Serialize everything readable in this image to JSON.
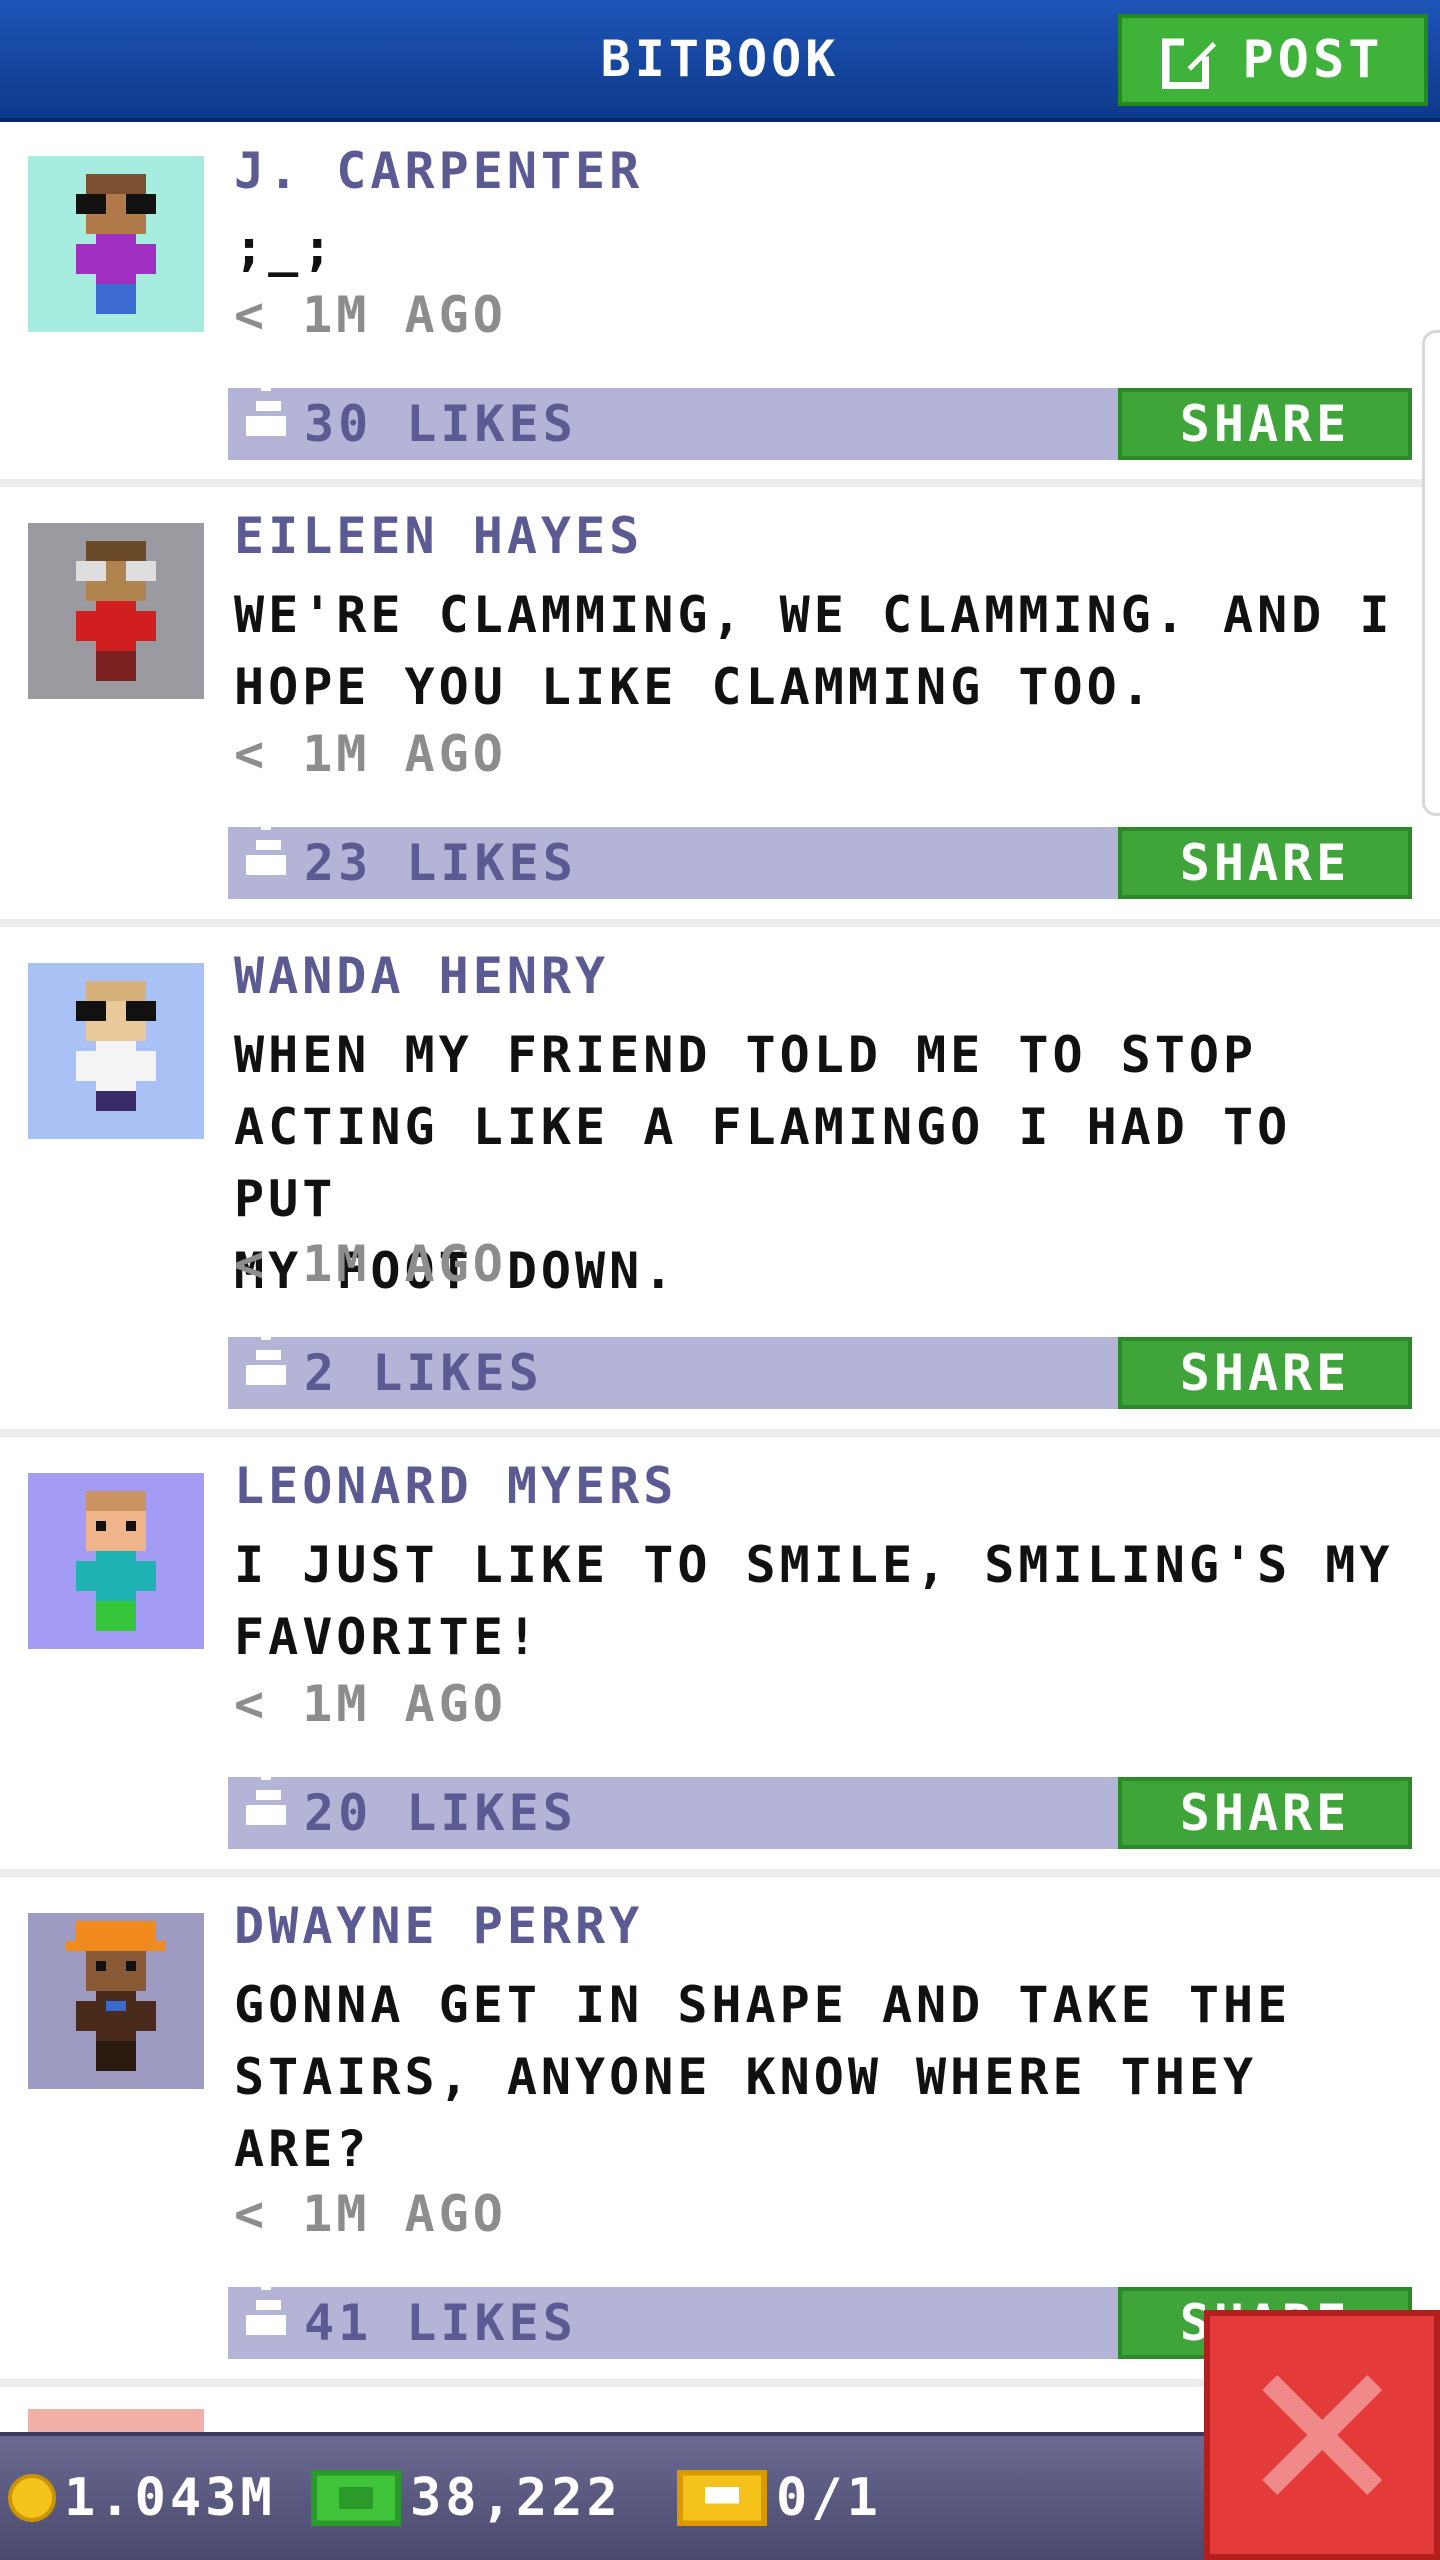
{
  "header": {
    "title": "BITBOOK",
    "post_label": "POST"
  },
  "posts": [
    {
      "name": "J. CARPENTER",
      "message": ";_;",
      "time": "< 1M AGO",
      "likes": "30 LIKES",
      "share": "SHARE",
      "avatar_bg": "#a6ede0"
    },
    {
      "name": "EILEEN HAYES",
      "message": "WE'RE CLAMMING, WE CLAMMING. AND I\nHOPE YOU LIKE CLAMMING TOO.",
      "time": "< 1M AGO",
      "likes": "23 LIKES",
      "share": "SHARE",
      "avatar_bg": "#9a9aa0"
    },
    {
      "name": "WANDA HENRY",
      "message": "WHEN MY FRIEND TOLD ME TO STOP\nACTING LIKE A FLAMINGO I HAD TO PUT\nMY FOOT DOWN.",
      "time": "< 1M AGO",
      "likes": "2 LIKES",
      "share": "SHARE",
      "avatar_bg": "#a9c1f4"
    },
    {
      "name": "LEONARD MYERS",
      "message": "I JUST LIKE TO SMILE, SMILING'S MY\nFAVORITE!",
      "time": "< 1M AGO",
      "likes": "20 LIKES",
      "share": "SHARE",
      "avatar_bg": "#a49cf4"
    },
    {
      "name": "DWAYNE PERRY",
      "message": "GONNA GET IN SHAPE AND TAKE THE\nSTAIRS, ANYONE KNOW WHERE THEY\nARE?",
      "time": "< 1M AGO",
      "likes": "41 LIKES",
      "share": "SHARE",
      "avatar_bg": "#9d9bc1"
    }
  ],
  "status_bar": {
    "coins": "1.043M",
    "bux": "38,222",
    "vip": "0/1"
  },
  "colors": {
    "header": "#1e55b8",
    "accent_green": "#3fb23a",
    "likes_bar": "#b3b4d6",
    "name_text": "#5b5a92",
    "close_red": "#e53a3a"
  },
  "icons": {
    "post": "edit-icon",
    "like": "thumbs-up-icon",
    "coin": "coin-icon",
    "bux": "bux-icon",
    "vip": "ticket-icon",
    "close": "close-icon"
  }
}
